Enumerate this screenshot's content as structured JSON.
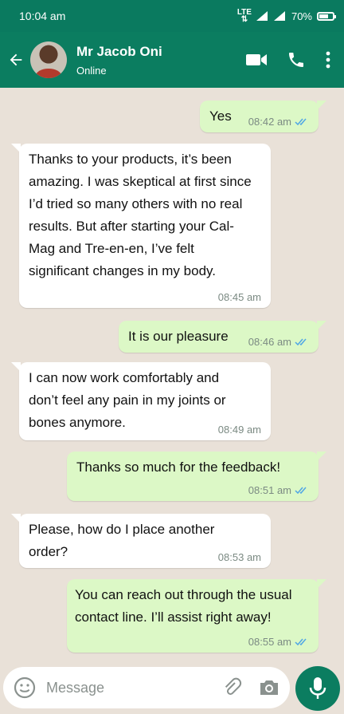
{
  "status_bar": {
    "time": "10:04 am",
    "network": "LTE",
    "battery": "70%",
    "battery_level": 0.7
  },
  "header": {
    "contact_name": "Mr Jacob Oni",
    "contact_status": "Online",
    "icons": [
      "back-arrow-icon",
      "video-call-icon",
      "phone-icon",
      "more-vert-icon"
    ]
  },
  "messages": [
    {
      "direction": "out",
      "text": "Yes",
      "time": "08:42 am",
      "read": true
    },
    {
      "direction": "in",
      "lines": [
        "Thanks to your products, it’s been",
        "amazing. I was skeptical at first since",
        "I’d tried so many others with no real",
        "results. But after starting your Cal-",
        "Mag and Tre-en-en, I’ve felt",
        "significant changes in my body."
      ],
      "time": "08:45 am"
    },
    {
      "direction": "out",
      "text": "It is our pleasure",
      "time": "08:46 am",
      "read": true
    },
    {
      "direction": "in",
      "lines": [
        "I can now work comfortably and",
        "don’t feel any pain in my joints or",
        "bones anymore."
      ],
      "time": "08:49 am"
    },
    {
      "direction": "out",
      "text": "Thanks so much for the feedback!",
      "time": "08:51 am",
      "read": true
    },
    {
      "direction": "in",
      "lines": [
        "Please, how do I place another",
        "order?"
      ],
      "time": "08:53 am"
    },
    {
      "direction": "out",
      "lines": [
        "You can reach out through the usual",
        "contact line. I’ll assist right away!"
      ],
      "time": "08:55 am",
      "read": true
    }
  ],
  "composer": {
    "placeholder": "Message",
    "icons": [
      "emoji-icon",
      "attach-icon",
      "camera-icon",
      "mic-icon"
    ]
  },
  "colors": {
    "header": "#0b7d60",
    "outgoing_bubble": "#dcf8c6",
    "incoming_bubble": "#ffffff",
    "read_ticks": "#4fa6e6",
    "chat_background": "#e9e1d8"
  }
}
